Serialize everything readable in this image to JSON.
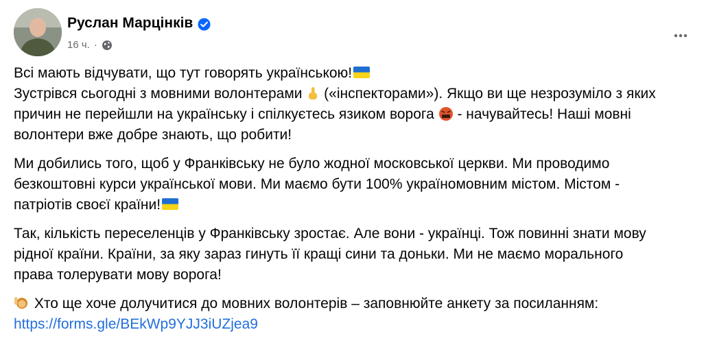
{
  "post": {
    "author_name": "Руслан Марцінків",
    "time_label": "16 ч.",
    "separator": "·"
  },
  "icons": {
    "verified": "verified-badge-icon",
    "audience": "globe-icon",
    "menu": "more-options-icon",
    "accent_color": "#216fdb"
  },
  "content": {
    "p1_l1_a": "Всі мають відчувати, що тут говорять українською!",
    "p1_l2_a": "Зустрівся сьогодні з мовними волонтерами",
    "p1_l2_b": " («інспекторами»). Якщо ви ще незрозуміло з яких",
    "p1_l3_a": "причин не перейшли на українську і спілкуєтесь язиком ворога",
    "p1_l3_b": " - начувайтесь! Наші мовні",
    "p1_l4": "волонтери вже добре знають, що робити!",
    "p2_l1": "Ми добились того, щоб у Франківську не було жодної московської церкви. Ми проводимо",
    "p2_l2": "безкоштовні курси української мови. Ми маємо бути 100% україномовним містом. Містом -",
    "p2_l3": "патріотів своєї країни!",
    "p3_l1": "Так, кількість переселенців у Франківську зростає. Але вони - українці. Тож повинні знати мову",
    "p3_l2": "рідної країни. Країни, за яку зараз гинуть її кращі сини та доньки. Ми не маємо морального",
    "p3_l3": "права толерувати мову ворога!",
    "p4_l1": "Хто ще хоче долучитися до мовних волонтерів – заповнюйте анкету за посиланням:",
    "p4_link": "https://forms.gle/BEkWp9YJJ3iUZjea9"
  }
}
